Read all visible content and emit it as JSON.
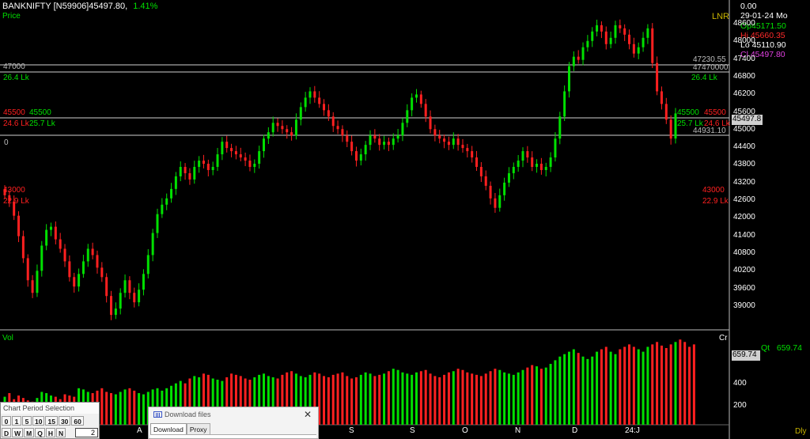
{
  "header": {
    "symbol": "BANKNIFTY",
    "contract": "[N59906]",
    "last": "45497.80,",
    "change_pct": "1.41%",
    "price_label": "Price",
    "indicator": "LNR"
  },
  "info_panel": {
    "value": "0.00",
    "date": "29-01-24 Mo",
    "open": "Op45171.50",
    "high": "Hi  45660.35",
    "low": "Lo  45110.90",
    "close": "Cl  45497.80",
    "colors": {
      "open": "#00e000",
      "high": "#ff2a2a",
      "low": "#ffffff",
      "close": "#e040e0"
    }
  },
  "price_axis": [
    "48600",
    "48000",
    "47400",
    "46800",
    "46200",
    "45600",
    "45000",
    "44400",
    "43800",
    "43200",
    "42600",
    "42000",
    "41400",
    "40800",
    "40200",
    "39600",
    "39000"
  ],
  "current_price_tag": "45497.8",
  "levels": {
    "l47000_left": "47000",
    "l47000_left_vol": "26.4 Lk",
    "l47000_right_val": "47230.55",
    "l47000_right_line": "47470000",
    "l47000_right_vol": "26.4 Lk",
    "l45500_left_a": "45500",
    "l45500_left_b": "45500",
    "l45500_left_vol_a": "24.6 Lk",
    "l45500_left_vol_b": "25.7 Lk",
    "l45500_right_a": "45500",
    "l45500_right_b": "45500",
    "l45500_right_vol_a": "25.7 Lk",
    "l45500_right_vol_b": "24.6 Lk",
    "l44931": "44931.10",
    "zero": "0",
    "l43000_left": "43000",
    "l43000_left_vol": "22.9 Lk",
    "l43000_right": "43000",
    "l43000_right_vol": "22.9 Lk"
  },
  "volume": {
    "label": "Vol",
    "unit": "Cr",
    "qt_label": "Qt",
    "qt_value": "659.74",
    "tag": "659.74",
    "axis": [
      "400",
      "200"
    ]
  },
  "x_axis": [
    "A",
    "S",
    "O",
    "N",
    "D",
    "24:J"
  ],
  "timeframe": "Dly",
  "chart_period": {
    "title": "Chart Period Selection",
    "row1": [
      "0",
      "1",
      "5",
      "10",
      "15",
      "30",
      "60"
    ],
    "row2": [
      "D",
      "W",
      "M",
      "Q",
      "H",
      "N"
    ],
    "input_value": "2"
  },
  "download_dialog": {
    "title": "Download files",
    "tabs": [
      "Download",
      "Proxy"
    ]
  },
  "chart_data": {
    "type": "candlestick",
    "title": "",
    "ylim": [
      38700,
      48900
    ],
    "x_ticks": [
      "A",
      "S",
      "O",
      "N",
      "D",
      "24:J"
    ],
    "colors": {
      "up": "#00e000",
      "down": "#ff2020"
    },
    "closes": [
      42900,
      42700,
      42250,
      41600,
      40900,
      40200,
      39800,
      40500,
      41300,
      41800,
      41900,
      41500,
      41200,
      40800,
      40300,
      40000,
      40400,
      40800,
      41200,
      41000,
      40600,
      40300,
      39700,
      39100,
      39300,
      39800,
      40200,
      39800,
      39500,
      39900,
      40400,
      41000,
      41700,
      42300,
      42600,
      42800,
      43100,
      43500,
      43800,
      43600,
      43400,
      43800,
      44000,
      43900,
      43700,
      43800,
      44200,
      44600,
      44400,
      44300,
      44200,
      44100,
      44000,
      43800,
      43900,
      44300,
      44700,
      44900,
      45200,
      45100,
      45000,
      44900,
      44800,
      45300,
      45700,
      46000,
      46200,
      46000,
      45800,
      45600,
      45400,
      45100,
      45000,
      44800,
      44600,
      44300,
      44000,
      44200,
      44500,
      44800,
      44700,
      44500,
      44600,
      44500,
      44700,
      44800,
      45200,
      45600,
      46000,
      46100,
      45800,
      45400,
      45000,
      44800,
      44700,
      44600,
      44500,
      44700,
      44500,
      44400,
      44300,
      44100,
      43800,
      43500,
      43200,
      42800,
      42500,
      42900,
      43300,
      43600,
      43800,
      44000,
      44300,
      44100,
      43800,
      43900,
      43700,
      43800,
      44100,
      44700,
      45400,
      46200,
      47000,
      47300,
      47200,
      47600,
      47800,
      48100,
      48300,
      48100,
      47700,
      47900,
      48300,
      48200,
      48000,
      47700,
      47400,
      47600,
      47900,
      48200,
      47100,
      46200,
      45800,
      45300,
      44700,
      45497.8
    ],
    "volume": [
      230,
      260,
      210,
      240,
      220,
      200,
      190,
      220,
      270,
      260,
      240,
      230,
      210,
      250,
      240,
      230,
      300,
      290,
      270,
      260,
      280,
      300,
      270,
      260,
      250,
      270,
      290,
      300,
      280,
      260,
      250,
      270,
      290,
      300,
      280,
      300,
      320,
      340,
      360,
      340,
      380,
      400,
      390,
      420,
      410,
      380,
      370,
      360,
      390,
      420,
      410,
      400,
      380,
      370,
      390,
      410,
      420,
      400,
      390,
      380,
      410,
      430,
      440,
      420,
      400,
      390,
      410,
      430,
      420,
      400,
      390,
      410,
      420,
      430,
      400,
      380,
      390,
      410,
      430,
      420,
      400,
      410,
      420,
      440,
      460,
      450,
      430,
      420,
      410,
      430,
      440,
      450,
      420,
      400,
      390,
      410,
      430,
      440,
      460,
      450,
      430,
      420,
      410,
      400,
      420,
      440,
      460,
      450,
      430,
      420,
      410,
      430,
      450,
      470,
      490,
      480,
      460,
      470,
      500,
      530,
      560,
      580,
      600,
      620,
      590,
      560,
      540,
      560,
      600,
      620,
      640,
      600,
      580,
      620,
      640,
      660,
      640,
      620,
      600,
      640,
      660,
      680,
      650,
      630,
      660,
      680,
      700,
      680,
      640,
      660
    ],
    "volume_ylim": [
      0,
      760
    ]
  }
}
